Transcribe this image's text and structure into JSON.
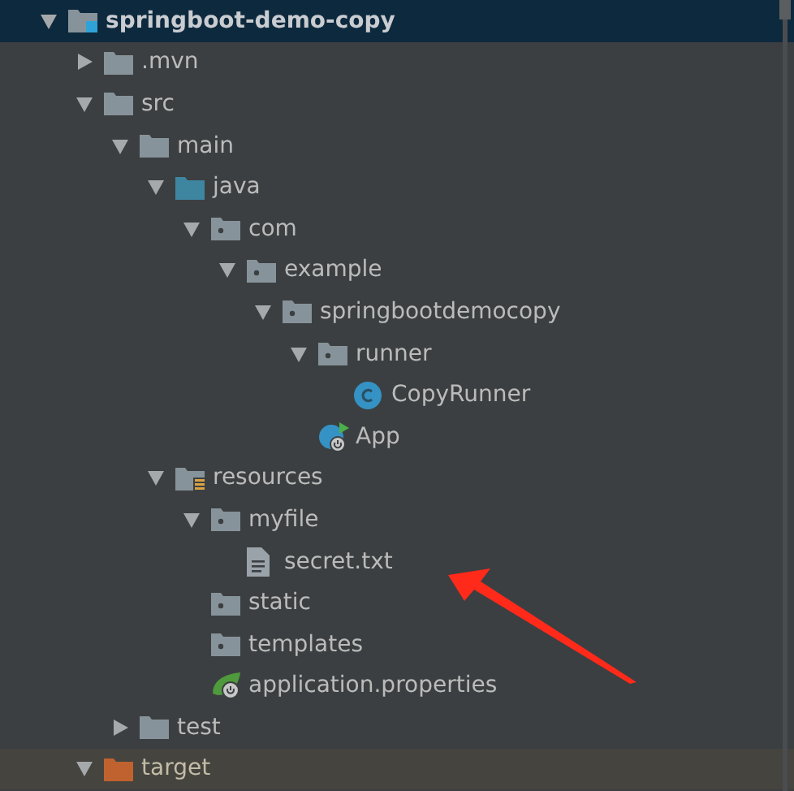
{
  "project_tree": [
    {
      "label": "springboot-demo-copy",
      "kind": "module",
      "selected": true,
      "expanded": true,
      "children": [
        {
          "label": ".mvn",
          "kind": "folder",
          "selected": false,
          "expanded": false
        },
        {
          "label": "src",
          "kind": "folder",
          "selected": false,
          "expanded": true,
          "children": [
            {
              "label": "main",
              "kind": "folder",
              "selected": false,
              "expanded": true,
              "children": [
                {
                  "label": "java",
                  "kind": "source-folder",
                  "selected": false,
                  "expanded": true,
                  "children": [
                    {
                      "label": "com",
                      "kind": "package",
                      "selected": false,
                      "expanded": true,
                      "children": [
                        {
                          "label": "example",
                          "kind": "package",
                          "selected": false,
                          "expanded": true,
                          "children": [
                            {
                              "label": "springbootdemocopy",
                              "kind": "package",
                              "selected": false,
                              "expanded": true,
                              "children": [
                                {
                                  "label": "runner",
                                  "kind": "package",
                                  "selected": false,
                                  "expanded": true,
                                  "children": [
                                    {
                                      "label": "CopyRunner",
                                      "kind": "class",
                                      "selected": false
                                    }
                                  ]
                                },
                                {
                                  "label": "App",
                                  "kind": "spring-app",
                                  "selected": false
                                }
                              ]
                            }
                          ]
                        }
                      ]
                    }
                  ]
                },
                {
                  "label": "resources",
                  "kind": "resources-folder",
                  "selected": false,
                  "expanded": true,
                  "children": [
                    {
                      "label": "myfile",
                      "kind": "package",
                      "selected": false,
                      "expanded": true,
                      "children": [
                        {
                          "label": "secret.txt",
                          "kind": "file",
                          "selected": false
                        }
                      ]
                    },
                    {
                      "label": "static",
                      "kind": "package",
                      "selected": false
                    },
                    {
                      "label": "templates",
                      "kind": "package",
                      "selected": false
                    },
                    {
                      "label": "application.properties",
                      "kind": "spring-properties",
                      "selected": false
                    }
                  ]
                }
              ]
            },
            {
              "label": "test",
              "kind": "folder",
              "selected": false,
              "expanded": false
            }
          ]
        },
        {
          "label": "target",
          "kind": "excluded-folder",
          "selected": false,
          "expanded": true,
          "ignored": true
        }
      ]
    }
  ]
}
